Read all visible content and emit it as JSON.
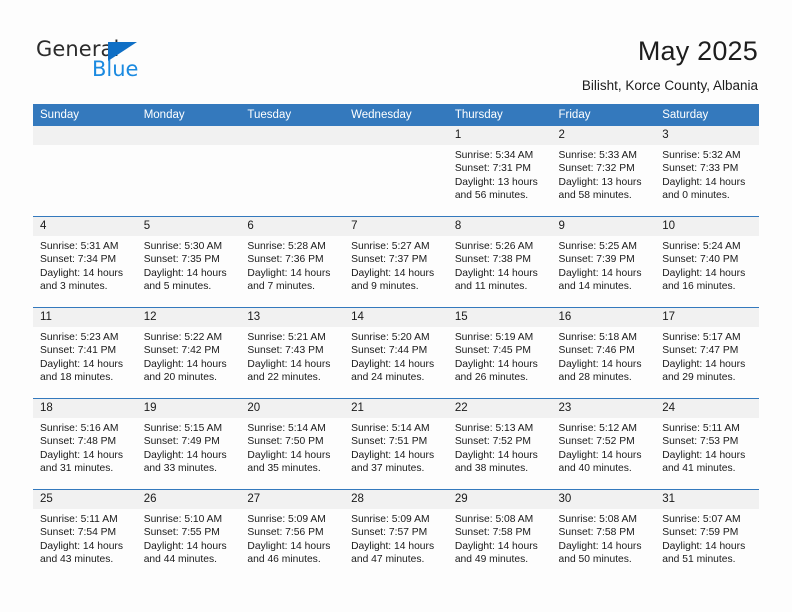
{
  "brand": {
    "name_part1": "General",
    "name_part2": "Blue",
    "triangle_color": "#0f6fc5",
    "blue_text_color": "#1b8ae0"
  },
  "header": {
    "title": "May 2025",
    "subtitle": "Bilisht, Korce County, Albania"
  },
  "theme": {
    "header_blue": "#3479bd",
    "daynum_gray": "#f1f1f1",
    "page_background": "#fdfdfd"
  },
  "columns": [
    "Sunday",
    "Monday",
    "Tuesday",
    "Wednesday",
    "Thursday",
    "Friday",
    "Saturday"
  ],
  "labels": {
    "sunrise_prefix": "Sunrise:",
    "sunset_prefix": "Sunset:",
    "daylight_prefix": "Daylight:"
  },
  "weeks": [
    [
      {
        "day": "",
        "empty": true
      },
      {
        "day": "",
        "empty": true
      },
      {
        "day": "",
        "empty": true
      },
      {
        "day": "",
        "empty": true
      },
      {
        "day": "1",
        "sunrise": "Sunrise: 5:34 AM",
        "sunset": "Sunset: 7:31 PM",
        "daylight_l1": "Daylight: 13 hours",
        "daylight_l2": "and 56 minutes."
      },
      {
        "day": "2",
        "sunrise": "Sunrise: 5:33 AM",
        "sunset": "Sunset: 7:32 PM",
        "daylight_l1": "Daylight: 13 hours",
        "daylight_l2": "and 58 minutes."
      },
      {
        "day": "3",
        "sunrise": "Sunrise: 5:32 AM",
        "sunset": "Sunset: 7:33 PM",
        "daylight_l1": "Daylight: 14 hours",
        "daylight_l2": "and 0 minutes."
      }
    ],
    [
      {
        "day": "4",
        "sunrise": "Sunrise: 5:31 AM",
        "sunset": "Sunset: 7:34 PM",
        "daylight_l1": "Daylight: 14 hours",
        "daylight_l2": "and 3 minutes."
      },
      {
        "day": "5",
        "sunrise": "Sunrise: 5:30 AM",
        "sunset": "Sunset: 7:35 PM",
        "daylight_l1": "Daylight: 14 hours",
        "daylight_l2": "and 5 minutes."
      },
      {
        "day": "6",
        "sunrise": "Sunrise: 5:28 AM",
        "sunset": "Sunset: 7:36 PM",
        "daylight_l1": "Daylight: 14 hours",
        "daylight_l2": "and 7 minutes."
      },
      {
        "day": "7",
        "sunrise": "Sunrise: 5:27 AM",
        "sunset": "Sunset: 7:37 PM",
        "daylight_l1": "Daylight: 14 hours",
        "daylight_l2": "and 9 minutes."
      },
      {
        "day": "8",
        "sunrise": "Sunrise: 5:26 AM",
        "sunset": "Sunset: 7:38 PM",
        "daylight_l1": "Daylight: 14 hours",
        "daylight_l2": "and 11 minutes."
      },
      {
        "day": "9",
        "sunrise": "Sunrise: 5:25 AM",
        "sunset": "Sunset: 7:39 PM",
        "daylight_l1": "Daylight: 14 hours",
        "daylight_l2": "and 14 minutes."
      },
      {
        "day": "10",
        "sunrise": "Sunrise: 5:24 AM",
        "sunset": "Sunset: 7:40 PM",
        "daylight_l1": "Daylight: 14 hours",
        "daylight_l2": "and 16 minutes."
      }
    ],
    [
      {
        "day": "11",
        "sunrise": "Sunrise: 5:23 AM",
        "sunset": "Sunset: 7:41 PM",
        "daylight_l1": "Daylight: 14 hours",
        "daylight_l2": "and 18 minutes."
      },
      {
        "day": "12",
        "sunrise": "Sunrise: 5:22 AM",
        "sunset": "Sunset: 7:42 PM",
        "daylight_l1": "Daylight: 14 hours",
        "daylight_l2": "and 20 minutes."
      },
      {
        "day": "13",
        "sunrise": "Sunrise: 5:21 AM",
        "sunset": "Sunset: 7:43 PM",
        "daylight_l1": "Daylight: 14 hours",
        "daylight_l2": "and 22 minutes."
      },
      {
        "day": "14",
        "sunrise": "Sunrise: 5:20 AM",
        "sunset": "Sunset: 7:44 PM",
        "daylight_l1": "Daylight: 14 hours",
        "daylight_l2": "and 24 minutes."
      },
      {
        "day": "15",
        "sunrise": "Sunrise: 5:19 AM",
        "sunset": "Sunset: 7:45 PM",
        "daylight_l1": "Daylight: 14 hours",
        "daylight_l2": "and 26 minutes."
      },
      {
        "day": "16",
        "sunrise": "Sunrise: 5:18 AM",
        "sunset": "Sunset: 7:46 PM",
        "daylight_l1": "Daylight: 14 hours",
        "daylight_l2": "and 28 minutes."
      },
      {
        "day": "17",
        "sunrise": "Sunrise: 5:17 AM",
        "sunset": "Sunset: 7:47 PM",
        "daylight_l1": "Daylight: 14 hours",
        "daylight_l2": "and 29 minutes."
      }
    ],
    [
      {
        "day": "18",
        "sunrise": "Sunrise: 5:16 AM",
        "sunset": "Sunset: 7:48 PM",
        "daylight_l1": "Daylight: 14 hours",
        "daylight_l2": "and 31 minutes."
      },
      {
        "day": "19",
        "sunrise": "Sunrise: 5:15 AM",
        "sunset": "Sunset: 7:49 PM",
        "daylight_l1": "Daylight: 14 hours",
        "daylight_l2": "and 33 minutes."
      },
      {
        "day": "20",
        "sunrise": "Sunrise: 5:14 AM",
        "sunset": "Sunset: 7:50 PM",
        "daylight_l1": "Daylight: 14 hours",
        "daylight_l2": "and 35 minutes."
      },
      {
        "day": "21",
        "sunrise": "Sunrise: 5:14 AM",
        "sunset": "Sunset: 7:51 PM",
        "daylight_l1": "Daylight: 14 hours",
        "daylight_l2": "and 37 minutes."
      },
      {
        "day": "22",
        "sunrise": "Sunrise: 5:13 AM",
        "sunset": "Sunset: 7:52 PM",
        "daylight_l1": "Daylight: 14 hours",
        "daylight_l2": "and 38 minutes."
      },
      {
        "day": "23",
        "sunrise": "Sunrise: 5:12 AM",
        "sunset": "Sunset: 7:52 PM",
        "daylight_l1": "Daylight: 14 hours",
        "daylight_l2": "and 40 minutes."
      },
      {
        "day": "24",
        "sunrise": "Sunrise: 5:11 AM",
        "sunset": "Sunset: 7:53 PM",
        "daylight_l1": "Daylight: 14 hours",
        "daylight_l2": "and 41 minutes."
      }
    ],
    [
      {
        "day": "25",
        "sunrise": "Sunrise: 5:11 AM",
        "sunset": "Sunset: 7:54 PM",
        "daylight_l1": "Daylight: 14 hours",
        "daylight_l2": "and 43 minutes."
      },
      {
        "day": "26",
        "sunrise": "Sunrise: 5:10 AM",
        "sunset": "Sunset: 7:55 PM",
        "daylight_l1": "Daylight: 14 hours",
        "daylight_l2": "and 44 minutes."
      },
      {
        "day": "27",
        "sunrise": "Sunrise: 5:09 AM",
        "sunset": "Sunset: 7:56 PM",
        "daylight_l1": "Daylight: 14 hours",
        "daylight_l2": "and 46 minutes."
      },
      {
        "day": "28",
        "sunrise": "Sunrise: 5:09 AM",
        "sunset": "Sunset: 7:57 PM",
        "daylight_l1": "Daylight: 14 hours",
        "daylight_l2": "and 47 minutes."
      },
      {
        "day": "29",
        "sunrise": "Sunrise: 5:08 AM",
        "sunset": "Sunset: 7:58 PM",
        "daylight_l1": "Daylight: 14 hours",
        "daylight_l2": "and 49 minutes."
      },
      {
        "day": "30",
        "sunrise": "Sunrise: 5:08 AM",
        "sunset": "Sunset: 7:58 PM",
        "daylight_l1": "Daylight: 14 hours",
        "daylight_l2": "and 50 minutes."
      },
      {
        "day": "31",
        "sunrise": "Sunrise: 5:07 AM",
        "sunset": "Sunset: 7:59 PM",
        "daylight_l1": "Daylight: 14 hours",
        "daylight_l2": "and 51 minutes."
      }
    ]
  ]
}
